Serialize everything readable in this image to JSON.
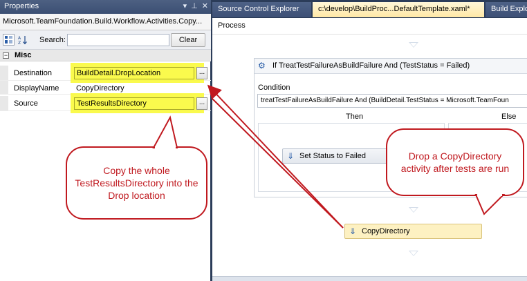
{
  "properties_panel": {
    "title": "Properties",
    "title_buttons": [
      "▾",
      "⊥",
      "✕"
    ],
    "object_name": "Microsoft.TeamFoundation.Build.Workflow.Activities.Copy...",
    "toolbar": {
      "categorized_icon": "categorized-icon",
      "alphabetical_icon": "alphabetical-icon",
      "search_label": "Search:",
      "search_value": "",
      "clear_label": "Clear"
    },
    "category": {
      "expander": "−",
      "label": "Misc"
    },
    "rows": [
      {
        "name": "Destination",
        "value": "BuildDetail.DropLocation",
        "ellipsis": "..."
      },
      {
        "name": "DisplayName",
        "value": "CopyDirectory"
      },
      {
        "name": "Source",
        "value": "TestResultsDirectory",
        "ellipsis": "..."
      }
    ],
    "highlight_color": "#f9f93a"
  },
  "tabs": [
    {
      "label": "Source Control Explorer",
      "active": false
    },
    {
      "label": "c:\\develop\\BuildProc...DefaultTemplate.xaml*",
      "active": true
    },
    {
      "label": "Build Explor",
      "active": false
    }
  ],
  "designer": {
    "breadcrumb": "Process",
    "if_activity": {
      "title": "If TreatTestFailureAsBuildFailure And (TestStatus = Failed)",
      "condition_label": "Condition",
      "condition_value": "treatTestFailureAsBuildFailure And (BuildDetail.TestStatus = Microsoft.TeamFoun",
      "then_label": "Then",
      "else_label": "Else",
      "then_activity": "Set Status to Failed"
    },
    "copy_directory_activity": "CopyDirectory",
    "selected_color": "#fdf1c2"
  },
  "callouts": {
    "left": "Copy the whole TestResultsDirectory into the Drop location",
    "right": "Drop a CopyDirectory activity after tests are run",
    "color": "#c0191f"
  }
}
